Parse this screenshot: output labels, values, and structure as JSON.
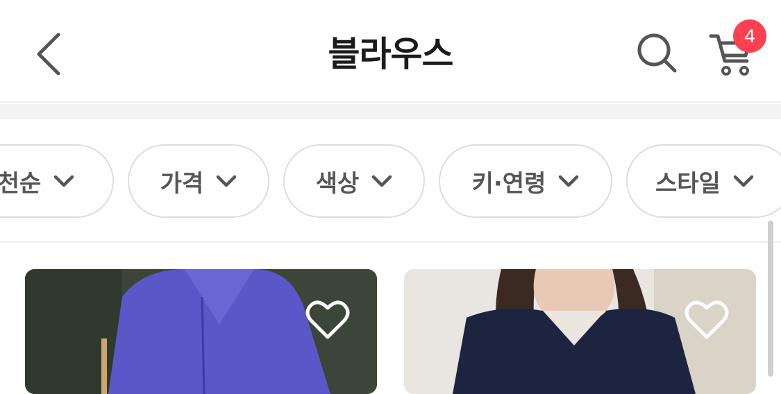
{
  "header": {
    "title": "블라우스",
    "back_icon": "chevron-left-icon",
    "search_icon": "search-icon",
    "cart_icon": "cart-icon",
    "cart_count": "4",
    "badge_color": "#ff4050"
  },
  "filters": [
    {
      "label": "신상품·인기순 (partially visible: 천순)",
      "visible_label": "천순"
    },
    {
      "label": "가격"
    },
    {
      "label": "색상"
    },
    {
      "label": "키·연령"
    },
    {
      "label": "스타일"
    }
  ],
  "products": [
    {
      "wishlist_icon": "heart-outline-icon"
    },
    {
      "wishlist_icon": "heart-outline-icon"
    }
  ]
}
